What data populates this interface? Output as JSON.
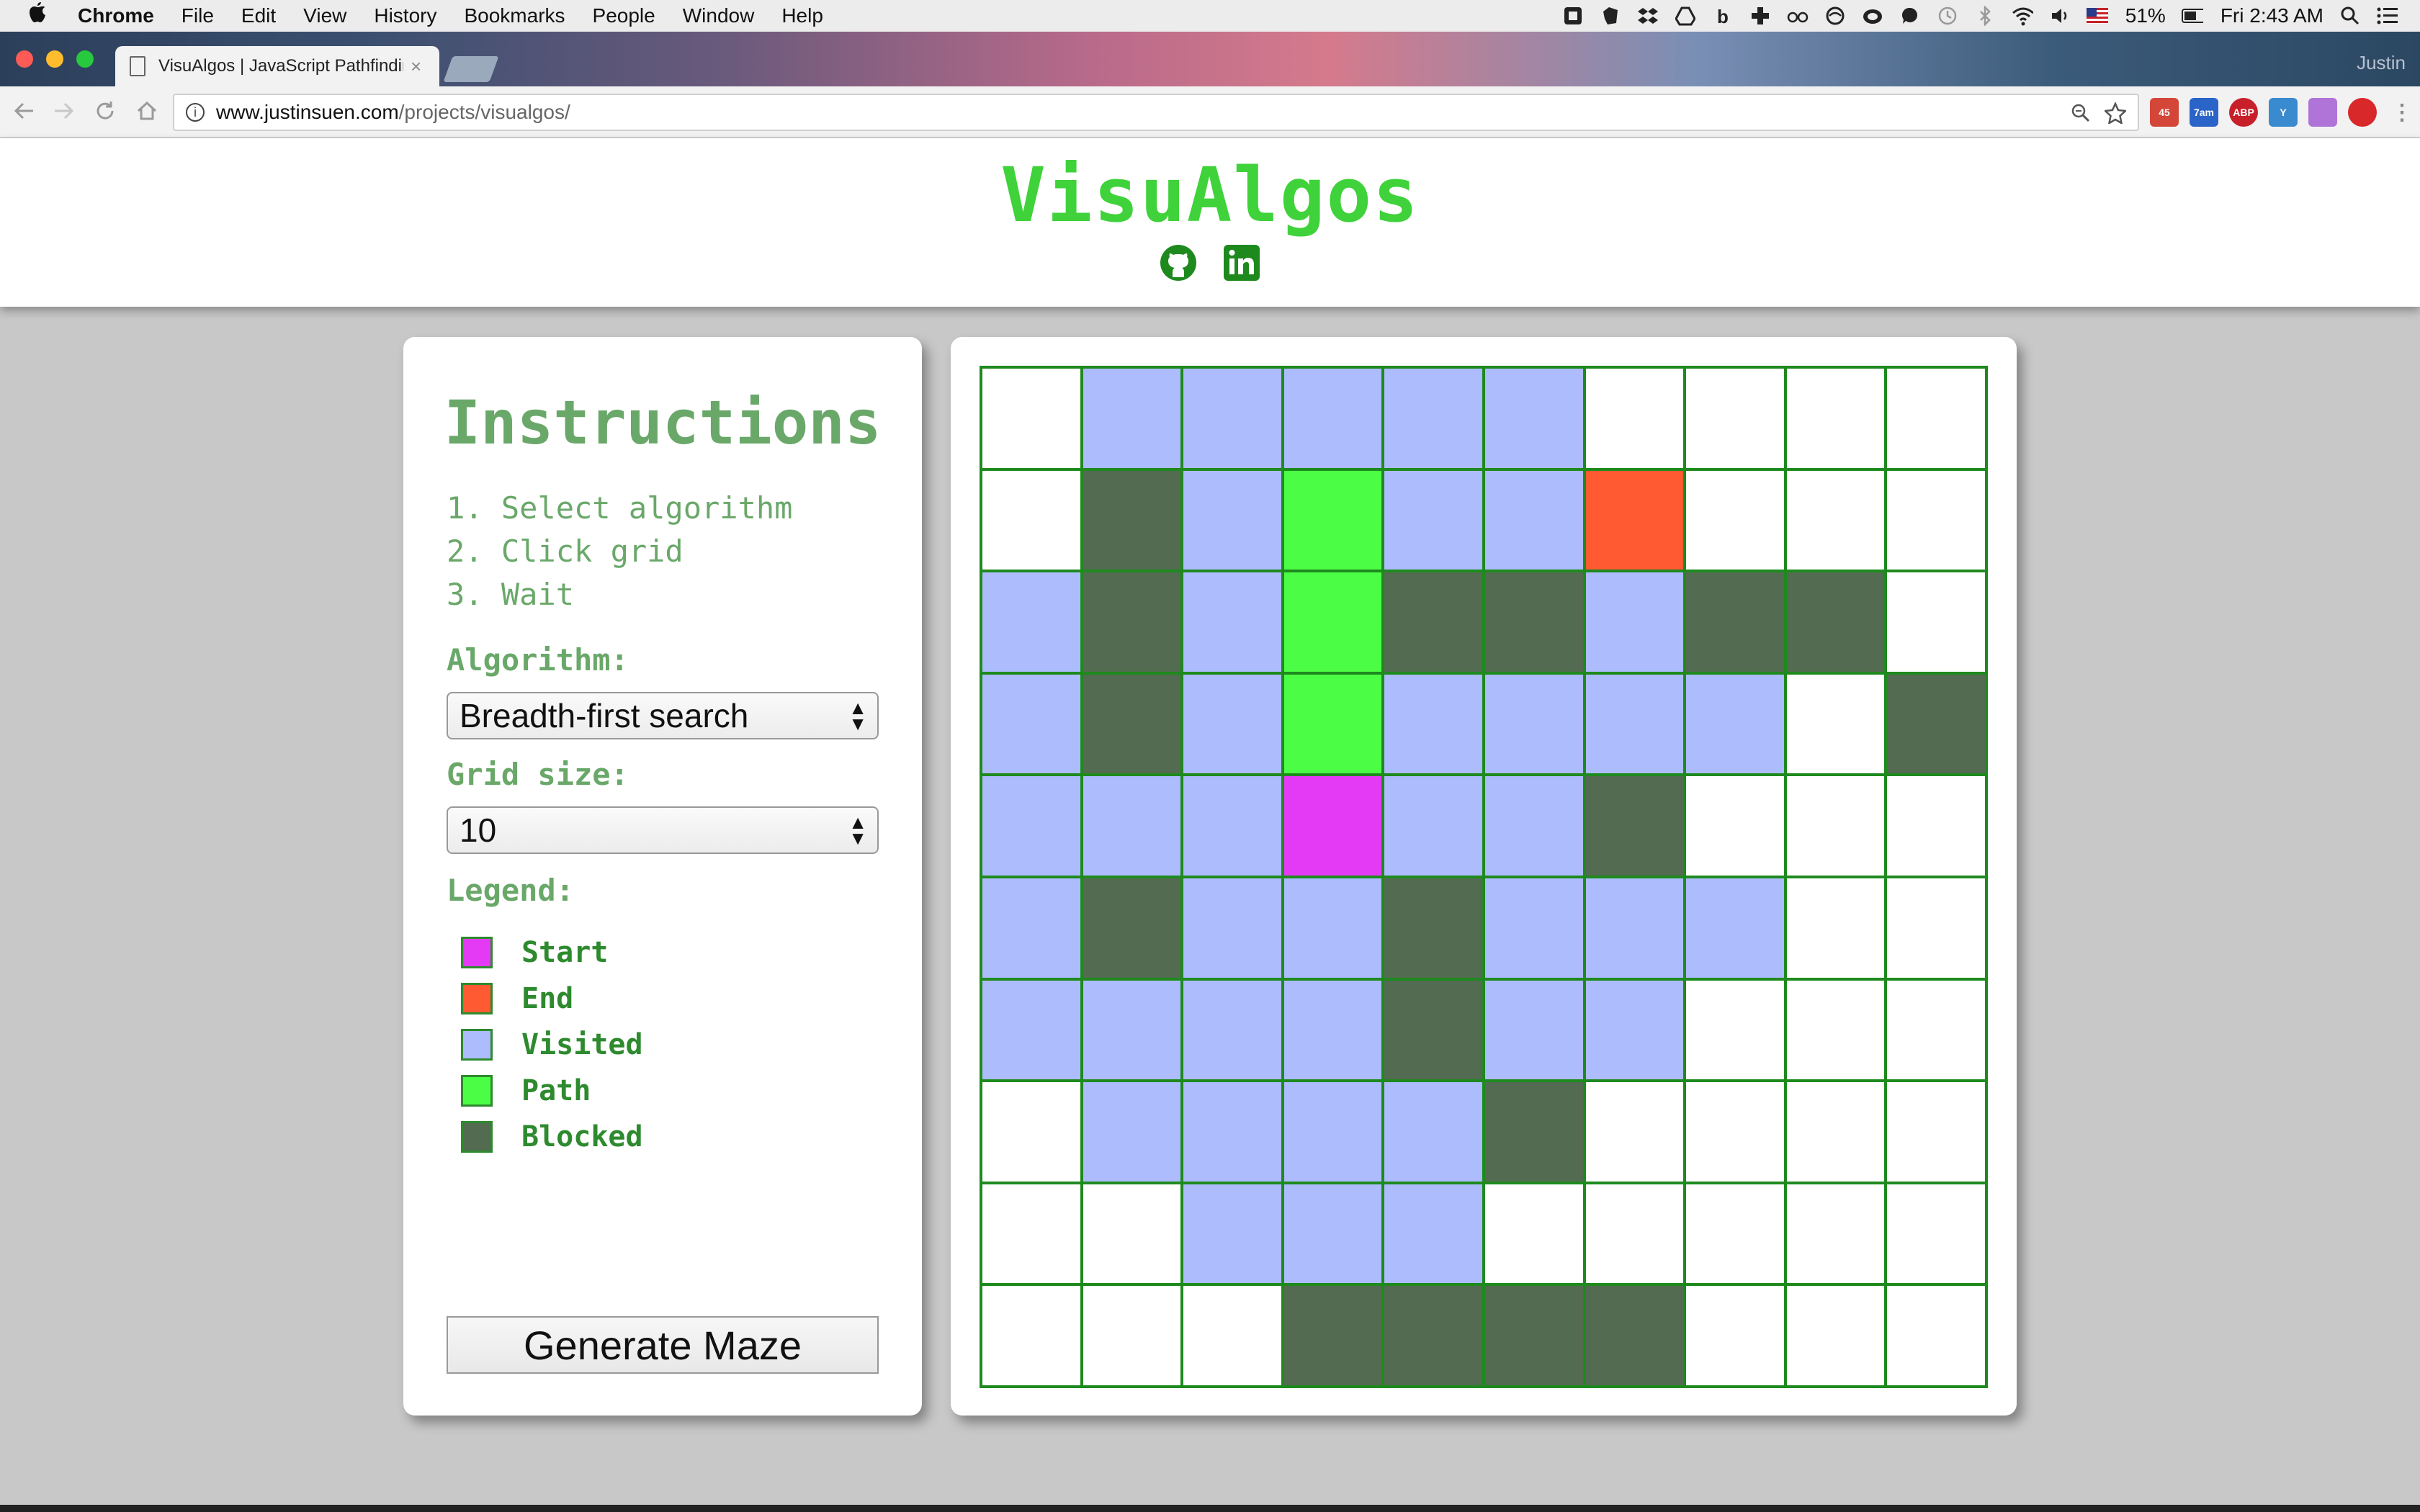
{
  "menubar": {
    "app": "Chrome",
    "items": [
      "File",
      "Edit",
      "View",
      "History",
      "Bookmarks",
      "People",
      "Window",
      "Help"
    ],
    "battery": "51%",
    "clock": "Fri 2:43 AM"
  },
  "tab": {
    "title": "VisuAlgos | JavaScript Pathfinding",
    "close": "×"
  },
  "profile": "Justin",
  "address": {
    "host": "www.justinsuen.com",
    "path": "/projects/visualgos/"
  },
  "extensions": [
    {
      "name": "gmail-icon",
      "badge": "45",
      "color": "#d44638"
    },
    {
      "name": "calendar-icon",
      "badge": "7am",
      "color": "#2a64c8"
    },
    {
      "name": "adblock-icon",
      "badge": "ABP",
      "color": "#c8202a"
    },
    {
      "name": "extension-y-icon",
      "badge": "Y",
      "color": "#3a8ad0"
    },
    {
      "name": "extension-paint-icon",
      "badge": "",
      "color": "#b074d8"
    },
    {
      "name": "record-icon",
      "badge": "",
      "color": "#d8282a"
    }
  ],
  "header": {
    "title": "VisuAlgos"
  },
  "instructions": {
    "title": "Instructions",
    "steps": [
      "1. Select algorithm",
      "2. Click grid",
      "3. Wait"
    ],
    "algorithm_label": "Algorithm:",
    "algorithm_value": "Breadth-first search",
    "grid_size_label": "Grid size:",
    "grid_size_value": "10",
    "legend_label": "Legend:",
    "legend": [
      {
        "label": "Start",
        "color": "#e53af5"
      },
      {
        "label": "End",
        "color": "#ff5a32"
      },
      {
        "label": "Visited",
        "color": "#adbcfd"
      },
      {
        "label": "Path",
        "color": "#4cfd45"
      },
      {
        "label": "Blocked",
        "color": "#536b51"
      }
    ],
    "generate_button": "Generate Maze"
  },
  "grid": {
    "size": 10,
    "colors": {
      "E": "#ffffff",
      "V": "#adbcfd",
      "B": "#536b51",
      "P": "#4cfd45",
      "S": "#e53af5",
      "X": "#ff5a32"
    },
    "rows": [
      "EVVVVVEEEE",
      "EBVPVVXEEE",
      "VBVPBBVBBE",
      "VBVPVVVVEB",
      "VVVSVVBEEE",
      "VBVVBVVVEE",
      "VVVVBVVEEE",
      "EVVVVBEEEE",
      "EEVVVEEEEE",
      "EEEBBBBEEE"
    ]
  }
}
